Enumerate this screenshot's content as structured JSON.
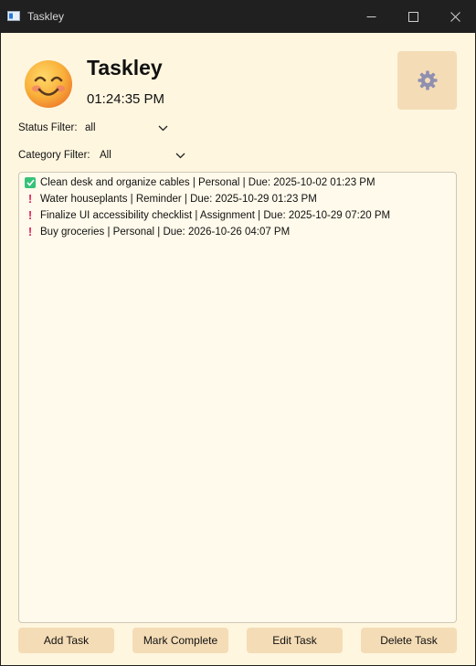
{
  "window": {
    "title": "Taskley"
  },
  "header": {
    "title": "Taskley",
    "time": "01:24:35 PM",
    "avatar_icon": "smiling-face-icon",
    "settings_icon": "gear-icon"
  },
  "filters": {
    "status": {
      "label": "Status Filter:",
      "value": "all"
    },
    "category": {
      "label": "Category Filter:",
      "value": "All"
    }
  },
  "tasks": [
    {
      "status": "complete",
      "icon": "check-box-icon",
      "text": "Clean desk and organize cables | Personal | Due: 2025-10-02 01:23 PM"
    },
    {
      "status": "pending",
      "icon": "exclamation-icon",
      "text": "Water houseplants | Reminder | Due: 2025-10-29 01:23 PM"
    },
    {
      "status": "pending",
      "icon": "exclamation-icon",
      "text": "Finalize UI accessibility checklist | Assignment | Due: 2025-10-29 07:20 PM"
    },
    {
      "status": "pending",
      "icon": "exclamation-icon",
      "text": "Buy groceries | Personal | Due: 2026-10-26 04:07 PM"
    }
  ],
  "buttons": {
    "add": "Add Task",
    "complete": "Mark Complete",
    "edit": "Edit Task",
    "delete": "Delete Task"
  },
  "colors": {
    "background": "#fff6df",
    "button": "#f4dcb6",
    "check": "#36c27a",
    "exclamation": "#e0245e"
  }
}
